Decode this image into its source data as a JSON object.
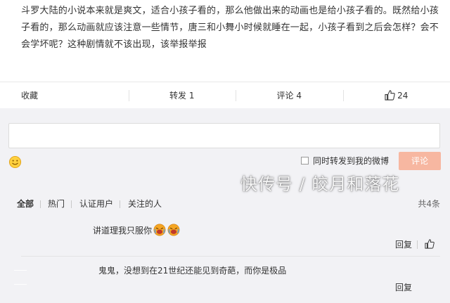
{
  "post": {
    "text": "斗罗大陆的小说本来就是爽文，适合小孩子看的，那么他做出来的动画也是给小孩子看的。既然给小孩子看的，那么动画就应该注意一些情节，唐三和小舞小时候就睡在一起，小孩子看到之后会怎样？会不会学坏呢？这种剧情就不该出现，该举报举报"
  },
  "actions": {
    "favorite": "收藏",
    "repost": "转发 1",
    "comment": "评论 4",
    "like_count": "24"
  },
  "comment_box": {
    "placeholder": "",
    "repost_label": "同时转发到我的微博",
    "submit": "评论",
    "emoji_icon": "smiley-icon"
  },
  "filters": {
    "all": "全部",
    "hot": "热门",
    "verified": "认证用户",
    "following": "关注的人",
    "total": "共4条"
  },
  "comments": [
    {
      "text": "讲道理我只服你",
      "reply": "回复",
      "emojis": [
        "laughing-cry-emoji",
        "laughing-cry-emoji"
      ]
    },
    {
      "text": "鬼鬼，没想到在21世纪还能见到奇葩，而你是极品",
      "reply": "回复"
    }
  ],
  "watermark": "快传号 / 皎月和落花",
  "colors": {
    "submit_bg": "#f7b7a1",
    "comment_area_bg": "#f2f2f5",
    "emoji_orange": "#f5a623"
  }
}
